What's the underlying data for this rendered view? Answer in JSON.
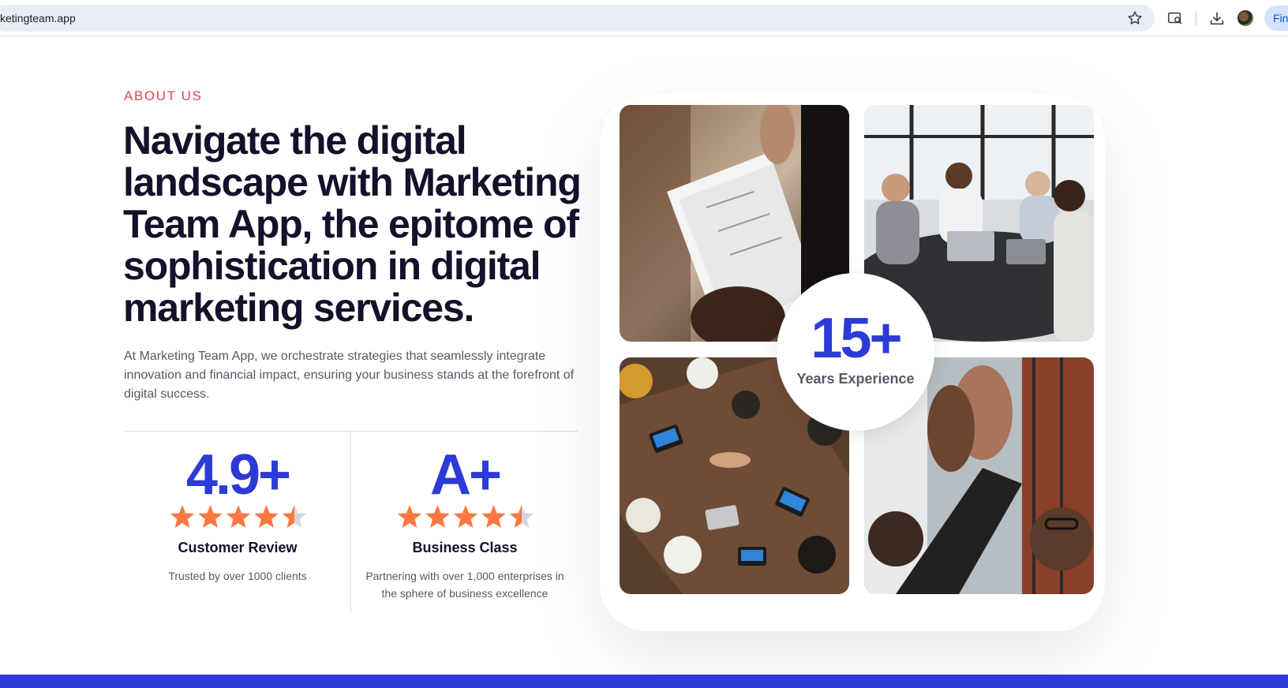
{
  "browser": {
    "url": "ketingteam.app",
    "find_label": "Fin"
  },
  "about": {
    "eyebrow": "ABOUT US",
    "headline": "Navigate the digital landscape with Marketing Team App, the epitome of sophistication in digital marketing services.",
    "intro": " At Marketing Team App, we orchestrate strategies that seamlessly integrate innovation and financial impact, ensuring your business stands at the forefront of digital success."
  },
  "stats": [
    {
      "value": "4.9+",
      "rating": 4.5,
      "title": "Customer Review",
      "desc": "Trusted by over 1000 clients"
    },
    {
      "value": "A+",
      "rating": 4.5,
      "title": "Business Class",
      "desc": "Partnering with over 1,000 enterprises in the sphere of business excellence"
    }
  ],
  "experience": {
    "value": "15+",
    "label": "Years Experience"
  },
  "photos": [
    "document-handoff-photo",
    "team-meeting-photo",
    "handshake-overhead-photo",
    "high-five-photo"
  ],
  "colors": {
    "accent": "#2c3ad8",
    "eyebrow": "#e8404f",
    "star": "#f97941",
    "star_empty": "#d5d7dc",
    "heading": "#15112b"
  }
}
